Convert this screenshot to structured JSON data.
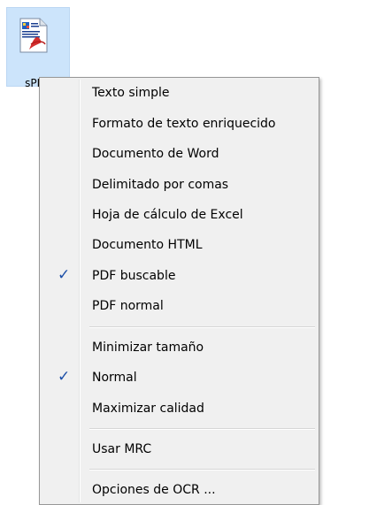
{
  "desktop_icon": {
    "label": "sPDF"
  },
  "menu": {
    "group_format": [
      {
        "label": "Texto simple",
        "checked": false
      },
      {
        "label": "Formato de texto enriquecido",
        "checked": false
      },
      {
        "label": "Documento de Word",
        "checked": false
      },
      {
        "label": "Delimitado por comas",
        "checked": false
      },
      {
        "label": "Hoja de cálculo de Excel",
        "checked": false
      },
      {
        "label": "Documento HTML",
        "checked": false
      },
      {
        "label": "PDF buscable",
        "checked": true
      },
      {
        "label": "PDF normal",
        "checked": false
      }
    ],
    "group_quality": [
      {
        "label": "Minimizar tamaño",
        "checked": false
      },
      {
        "label": "Normal",
        "checked": true
      },
      {
        "label": "Maximizar calidad",
        "checked": false
      }
    ],
    "mrc": {
      "label": "Usar MRC"
    },
    "ocr": {
      "label": "Opciones de OCR ..."
    },
    "check_glyph": "✓"
  }
}
